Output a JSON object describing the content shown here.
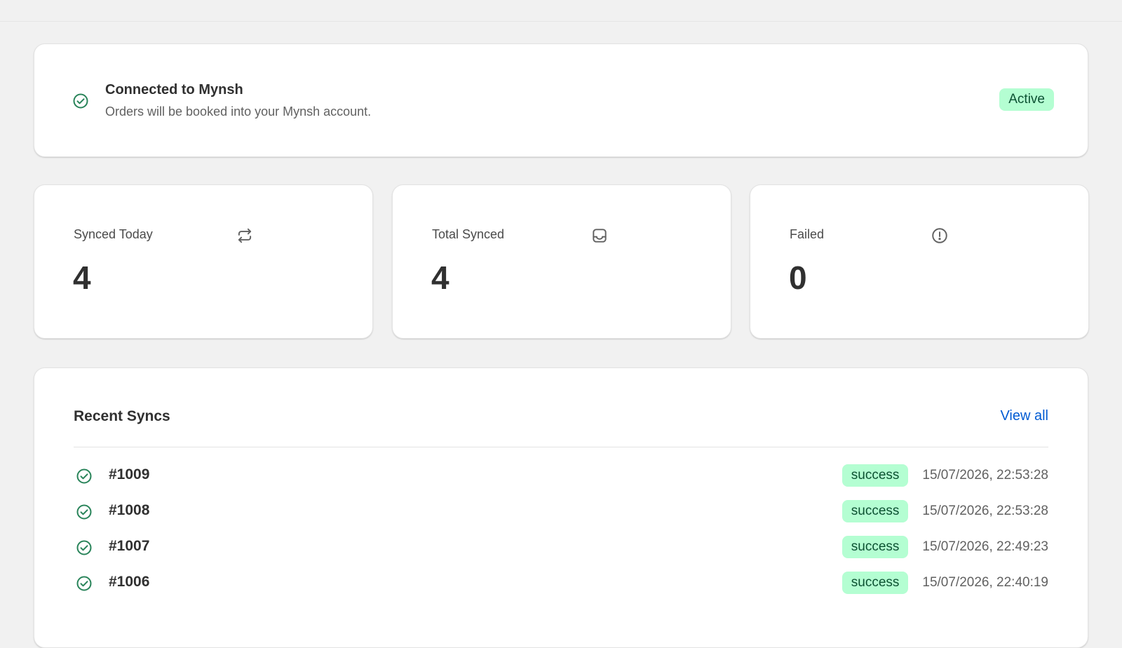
{
  "connection": {
    "title": "Connected to Mynsh",
    "subtitle": "Orders will be booked into your Mynsh account.",
    "status": "Active",
    "icon": "check-circle-icon"
  },
  "stats": [
    {
      "label": "Synced Today",
      "value": "4",
      "icon": "refresh-icon"
    },
    {
      "label": "Total Synced",
      "value": "4",
      "icon": "inbox-icon"
    },
    {
      "label": "Failed",
      "value": "0",
      "icon": "alert-circle-icon"
    }
  ],
  "recent": {
    "title": "Recent Syncs",
    "view_all": "View all",
    "rows": [
      {
        "order": "#1009",
        "status": "success",
        "time": "15/07/2026, 22:53:28"
      },
      {
        "order": "#1008",
        "status": "success",
        "time": "15/07/2026, 22:53:28"
      },
      {
        "order": "#1007",
        "status": "success",
        "time": "15/07/2026, 22:49:23"
      },
      {
        "order": "#1006",
        "status": "success",
        "time": "15/07/2026, 22:40:19"
      }
    ]
  },
  "colors": {
    "success_bg": "#b4fed2",
    "success_text": "#0c5132",
    "check_icon": "#29845a",
    "link": "#005bd3"
  }
}
